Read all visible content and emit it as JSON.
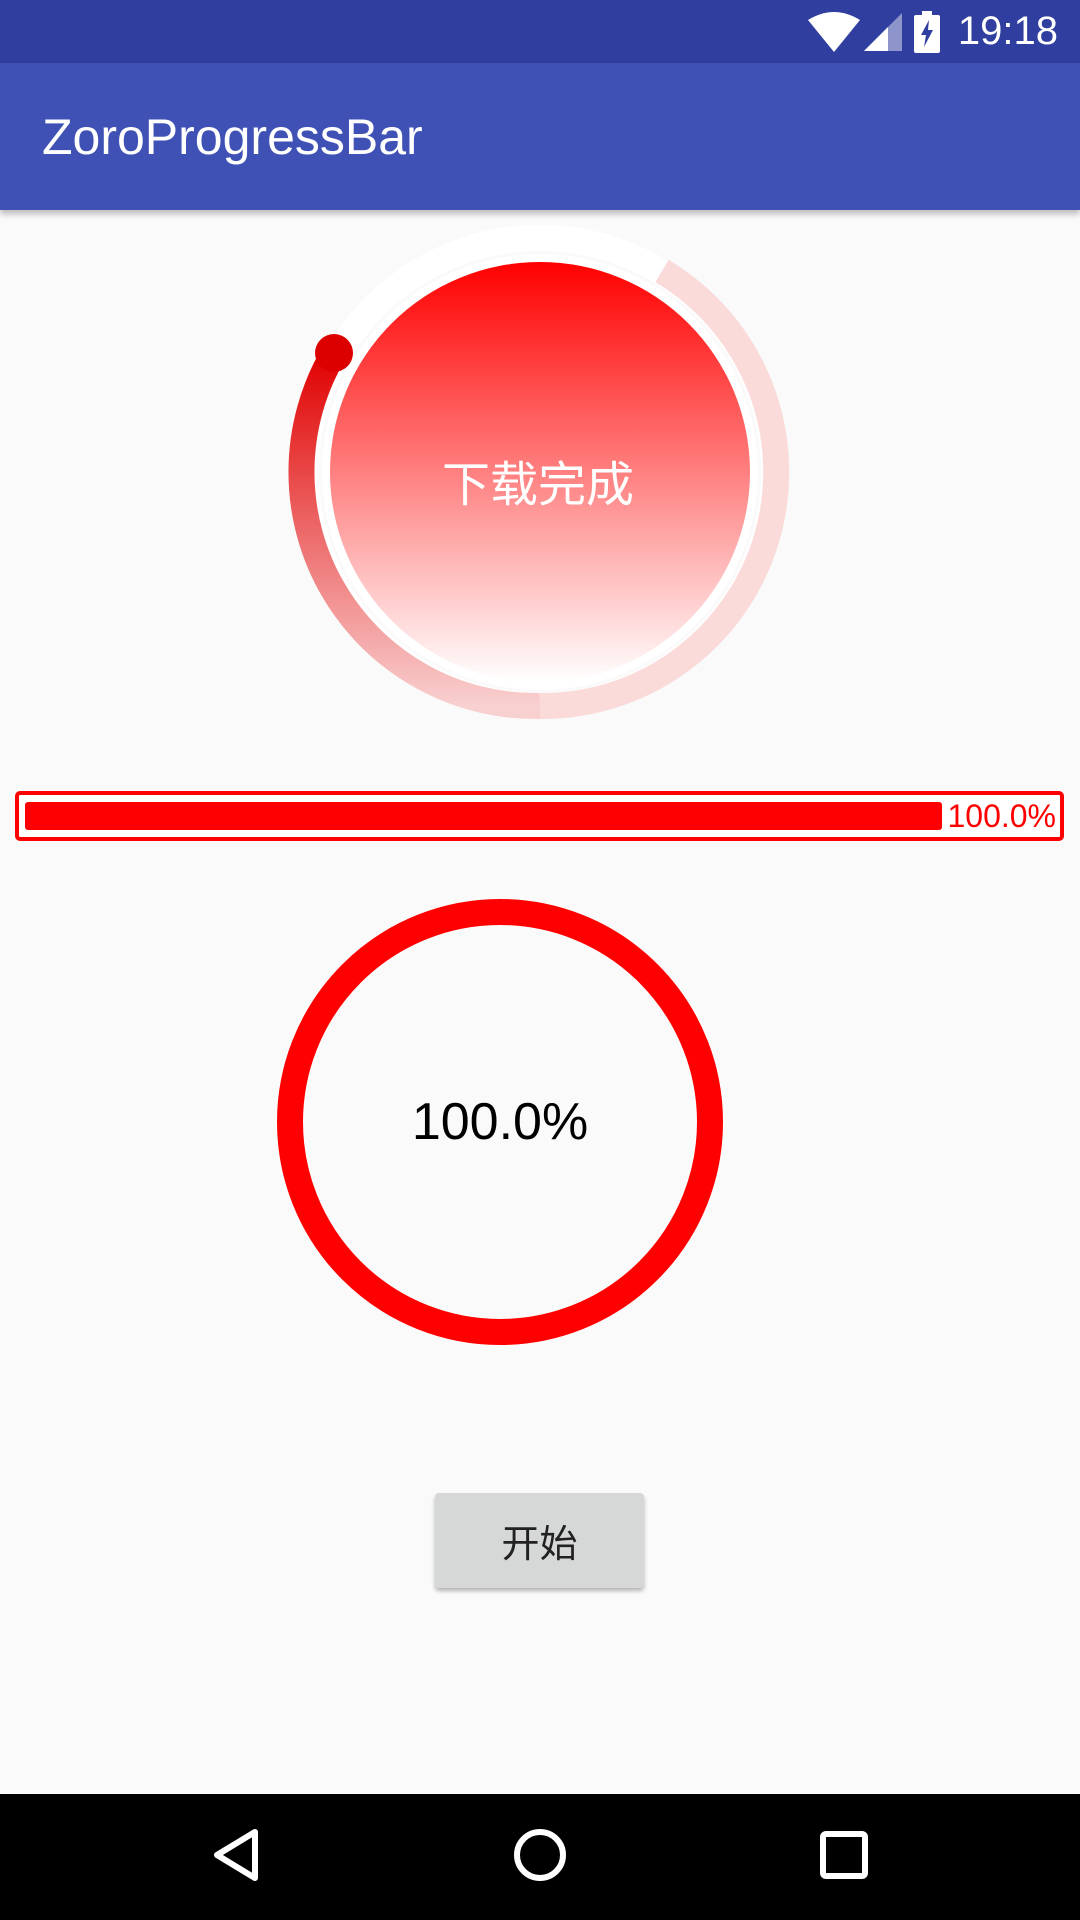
{
  "status_bar": {
    "time": "19:18",
    "icons": [
      "wifi-icon",
      "cell-signal-icon",
      "battery-charging-icon"
    ]
  },
  "app_bar": {
    "title": "ZoroProgressBar"
  },
  "gradient_progress": {
    "label": "下载完成",
    "arc_color": "#e00000",
    "fill_top_color": "#ff0000",
    "fill_bottom_color": "#ffffff"
  },
  "horizontal_progress": {
    "percent_text": "100.0%",
    "value": 1.0,
    "color": "#ff0000"
  },
  "ring_progress": {
    "percent_text": "100.0%",
    "value": 1.0,
    "color": "#ff0000"
  },
  "start_button": {
    "label": "开始"
  },
  "nav_bar": {
    "buttons": [
      "back-icon",
      "home-icon",
      "recents-icon"
    ]
  },
  "colors": {
    "status_bar": "#303f9f",
    "app_bar": "#3f51b5",
    "background": "#fafafa",
    "accent": "#ff0000"
  }
}
